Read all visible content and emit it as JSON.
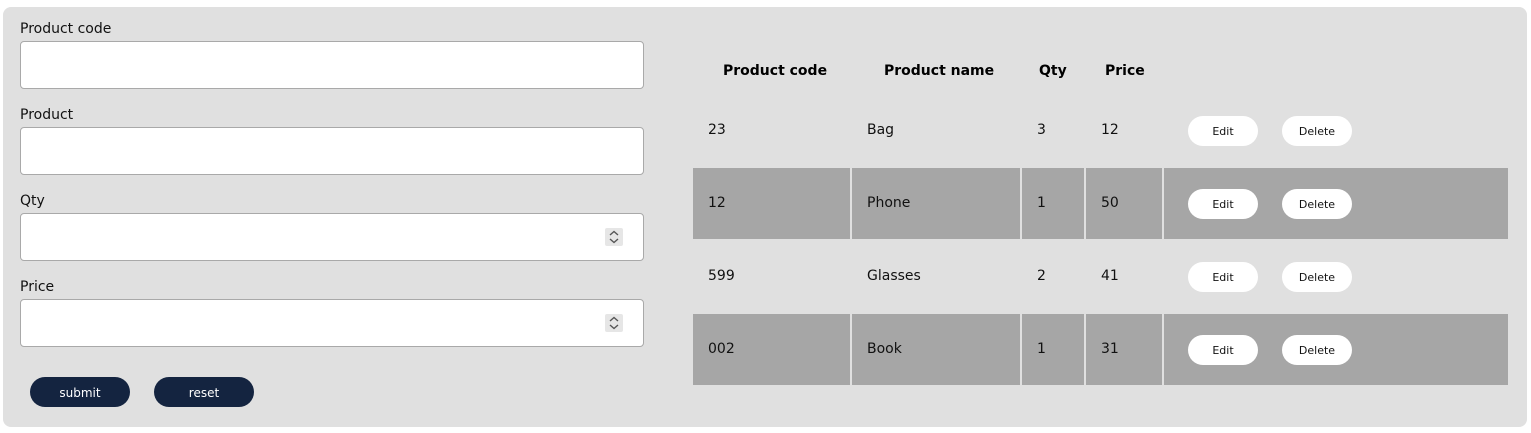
{
  "form": {
    "fields": [
      {
        "label": "Product code",
        "value": "",
        "spinner": false
      },
      {
        "label": "Product",
        "value": "",
        "spinner": false
      },
      {
        "label": "Qty",
        "value": "",
        "spinner": true
      },
      {
        "label": "Price",
        "value": "",
        "spinner": true
      }
    ],
    "submit_label": "submit",
    "reset_label": "reset"
  },
  "table": {
    "headers": [
      "Product code",
      "Product name",
      "Qty",
      "Price"
    ],
    "rows": [
      {
        "code": "23",
        "name": "Bag",
        "qty": "3",
        "price": "12"
      },
      {
        "code": "12",
        "name": "Phone",
        "qty": "1",
        "price": "50"
      },
      {
        "code": "599",
        "name": "Glasses",
        "qty": "2",
        "price": "41"
      },
      {
        "code": "002",
        "name": "Book",
        "qty": "1",
        "price": "31"
      }
    ],
    "edit_label": "Edit",
    "delete_label": "Delete"
  },
  "colors": {
    "panel_bg": "#e0e0e0",
    "alt_row_bg": "#a6a6a6",
    "primary_button": "#142440"
  }
}
